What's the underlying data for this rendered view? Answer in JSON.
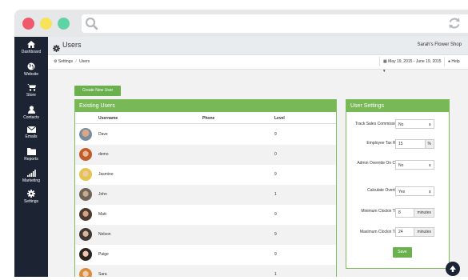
{
  "colors": {
    "accent_green": "#79b856",
    "sidebar": "#1c2434",
    "traffic_red": "#f0596b",
    "traffic_yellow": "#f6e35a",
    "traffic_green": "#5fd3a6"
  },
  "browser": {
    "search_icon": "search-icon",
    "reload_icon": "reload-icon"
  },
  "sidebar": {
    "items": [
      {
        "label": "Dashboard",
        "icon": "home-icon"
      },
      {
        "label": "Website",
        "icon": "globe-icon"
      },
      {
        "label": "Store",
        "icon": "cart-icon"
      },
      {
        "label": "Contacts",
        "icon": "user-icon"
      },
      {
        "label": "Emails",
        "icon": "envelope-icon"
      },
      {
        "label": "Reports",
        "icon": "folder-icon"
      },
      {
        "label": "Marketing",
        "icon": "signal-icon"
      },
      {
        "label": "Settings",
        "icon": "gear-icon"
      }
    ]
  },
  "header": {
    "title": "Users",
    "shop_name": "Sarah's Flower Shop"
  },
  "breadcrumb": {
    "root": "Settings",
    "separator": "/",
    "current": "Users"
  },
  "date_range": {
    "label": "May 19, 2015 - June 19, 2015"
  },
  "help": {
    "label": "Help"
  },
  "actions": {
    "create_user": "Create New User"
  },
  "users_panel": {
    "title": "Existing Users",
    "columns": [
      "Username",
      "Phone",
      "Level"
    ],
    "rows": [
      {
        "username": "Dave",
        "phone": "",
        "level": "9"
      },
      {
        "username": "demo",
        "phone": "",
        "level": "0"
      },
      {
        "username": "Jasmine",
        "phone": "",
        "level": "9"
      },
      {
        "username": "John",
        "phone": "",
        "level": "1"
      },
      {
        "username": "Matt",
        "phone": "",
        "level": "9"
      },
      {
        "username": "Nelson",
        "phone": "",
        "level": "9"
      },
      {
        "username": "Paige",
        "phone": "",
        "level": "9"
      },
      {
        "username": "Sara",
        "phone": "",
        "level": "1"
      }
    ]
  },
  "settings_panel": {
    "title": "User Settings",
    "track_sales": {
      "label": "Track Sales Commissions:",
      "value": "No"
    },
    "employee_tax": {
      "label": "Employee Tax Rate:",
      "value": "15",
      "unit": "%"
    },
    "admin_override": {
      "label": "Admin Override On Clock In:",
      "value": "No"
    },
    "calculate_overtime": {
      "label": "Calculate Overtime:",
      "value": "Yes"
    },
    "min_clockin": {
      "label": "Minimum Clockin Time:",
      "value": "8",
      "unit": "minutes"
    },
    "max_clockin": {
      "label": "Maximum Clockin Time:",
      "value": "24",
      "unit": "minutes"
    },
    "save": "Save"
  }
}
